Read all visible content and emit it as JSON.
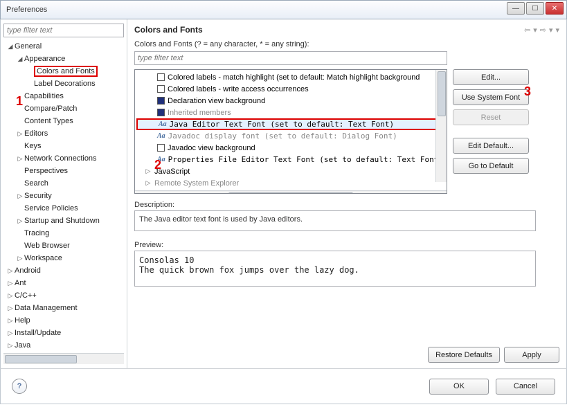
{
  "window": {
    "title": "Preferences"
  },
  "callouts": {
    "one": "1",
    "two": "2",
    "three": "3"
  },
  "sidebar": {
    "filter_placeholder": "type filter text",
    "items": [
      {
        "label": "General",
        "indent": 0,
        "expanded": true
      },
      {
        "label": "Appearance",
        "indent": 1,
        "expanded": true
      },
      {
        "label": "Colors and Fonts",
        "indent": 2,
        "annotated": true
      },
      {
        "label": "Label Decorations",
        "indent": 2
      },
      {
        "label": "Capabilities",
        "indent": 1
      },
      {
        "label": "Compare/Patch",
        "indent": 1
      },
      {
        "label": "Content Types",
        "indent": 1
      },
      {
        "label": "Editors",
        "indent": 1,
        "expandable": true
      },
      {
        "label": "Keys",
        "indent": 1
      },
      {
        "label": "Network Connections",
        "indent": 1,
        "expandable": true
      },
      {
        "label": "Perspectives",
        "indent": 1
      },
      {
        "label": "Search",
        "indent": 1
      },
      {
        "label": "Security",
        "indent": 1,
        "expandable": true
      },
      {
        "label": "Service Policies",
        "indent": 1
      },
      {
        "label": "Startup and Shutdown",
        "indent": 1,
        "expandable": true
      },
      {
        "label": "Tracing",
        "indent": 1
      },
      {
        "label": "Web Browser",
        "indent": 1
      },
      {
        "label": "Workspace",
        "indent": 1,
        "expandable": true
      },
      {
        "label": "Android",
        "indent": 0,
        "expandable": true
      },
      {
        "label": "Ant",
        "indent": 0,
        "expandable": true
      },
      {
        "label": "C/C++",
        "indent": 0,
        "expandable": true
      },
      {
        "label": "Data Management",
        "indent": 0,
        "expandable": true
      },
      {
        "label": "Help",
        "indent": 0,
        "expandable": true
      },
      {
        "label": "Install/Update",
        "indent": 0,
        "expandable": true
      },
      {
        "label": "Java",
        "indent": 0,
        "expandable": true
      }
    ]
  },
  "main": {
    "title": "Colors and Fonts",
    "subtitle": "Colors and Fonts (? = any character, * = any string):",
    "filter_placeholder": "type filter text",
    "items": [
      {
        "icon": "square",
        "color": "#fff",
        "label": "Colored labels - match highlight (set to default: Match highlight background"
      },
      {
        "icon": "square",
        "color": "#fff",
        "label": "Colored labels - write access occurrences"
      },
      {
        "icon": "square",
        "color": "#20307a",
        "label": "Declaration view background"
      },
      {
        "icon": "square",
        "color": "#20307a",
        "label": "Inherited members",
        "dim": true
      },
      {
        "icon": "aa",
        "mono": true,
        "label": "Java Editor Text Font (set to default: Text Font)",
        "annotated": true,
        "selected": true
      },
      {
        "icon": "aa",
        "mono": true,
        "label": "Javadoc display font (set to default: Dialog Font)",
        "dim": true
      },
      {
        "icon": "square",
        "color": "#fff",
        "label": "Javadoc view background"
      },
      {
        "icon": "aa",
        "mono": true,
        "label": "Properties File Editor Text Font (set to default: Text Font"
      },
      {
        "icon": "tri",
        "level": 1,
        "label": "JavaScript"
      },
      {
        "icon": "tri",
        "level": 1,
        "label": "Remote System Explorer",
        "dim": true
      }
    ],
    "buttons": {
      "edit": "Edit...",
      "use_system": "Use System Font",
      "reset": "Reset",
      "edit_default": "Edit Default...",
      "go_default": "Go to Default"
    },
    "description_label": "Description:",
    "description_text": "The Java editor text font is used by Java editors.",
    "preview_label": "Preview:",
    "preview_text": "Consolas 10\nThe quick brown fox jumps over the lazy dog.",
    "restore": "Restore Defaults",
    "apply": "Apply"
  },
  "footer": {
    "ok": "OK",
    "cancel": "Cancel"
  }
}
